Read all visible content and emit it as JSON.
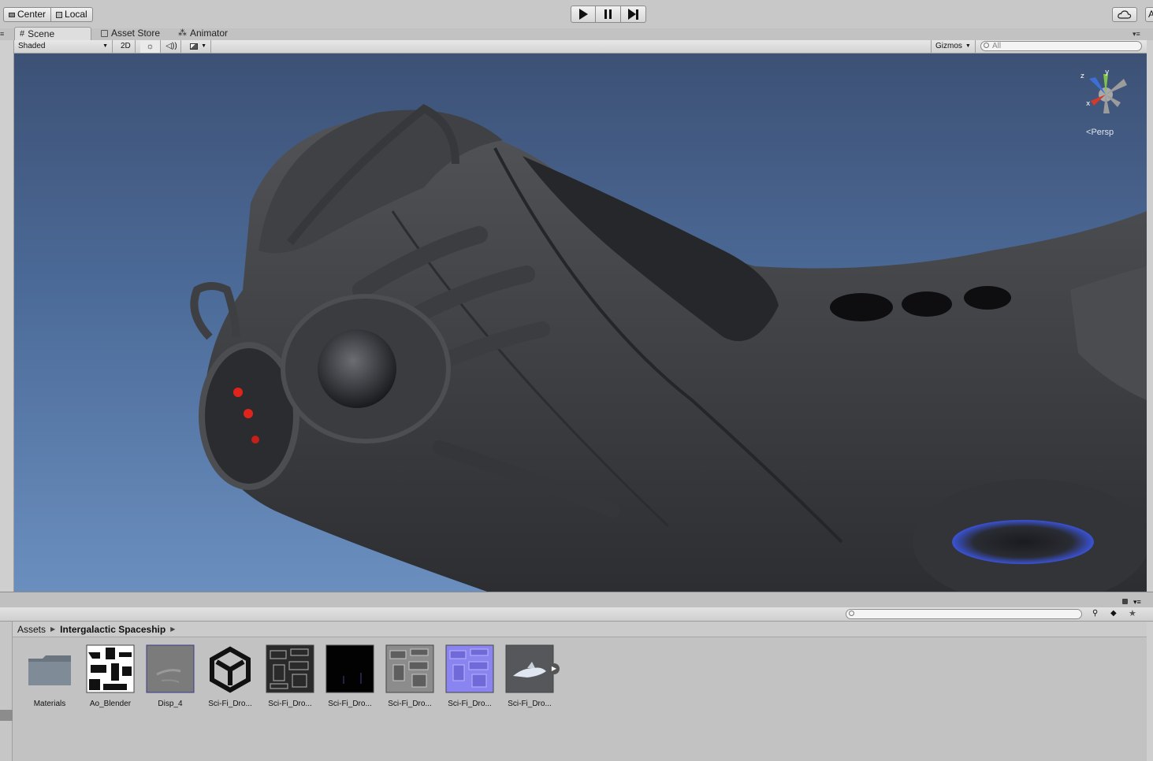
{
  "toolbar": {
    "center_label": "Center",
    "local_label": "Local",
    "cloud_icon": "cloud-icon",
    "account_initial": "A"
  },
  "tabs": [
    {
      "label": "Scene",
      "icon": "grid-icon",
      "active": true
    },
    {
      "label": "Asset Store",
      "icon": "store-icon",
      "active": false
    },
    {
      "label": "Animator",
      "icon": "animator-icon",
      "active": false
    }
  ],
  "scene_toolbar": {
    "shading_mode": "Shaded",
    "mode_2d": "2D",
    "gizmos_label": "Gizmos",
    "search_placeholder": "All"
  },
  "gizmo": {
    "axis_z": "z",
    "axis_y": "y",
    "axis_x": "x",
    "projection_label": "Persp",
    "colors": {
      "x": "#d23b2a",
      "y": "#7fc34a",
      "z": "#3d6fd4"
    }
  },
  "project": {
    "breadcrumb_root": "Assets",
    "breadcrumb_folder": "Intergalactic Spaceship",
    "search_placeholder": "",
    "assets": [
      {
        "label": "Materials",
        "kind": "folder"
      },
      {
        "label": "Ao_Blender",
        "kind": "texture-bw"
      },
      {
        "label": "Disp_4",
        "kind": "texture-gray"
      },
      {
        "label": "Sci-Fi_Dro...",
        "kind": "unity-logo"
      },
      {
        "label": "Sci-Fi_Dro...",
        "kind": "texture-dark"
      },
      {
        "label": "Sci-Fi_Dro...",
        "kind": "texture-black"
      },
      {
        "label": "Sci-Fi_Dro...",
        "kind": "texture-gray2"
      },
      {
        "label": "Sci-Fi_Dro...",
        "kind": "texture-normal"
      },
      {
        "label": "Sci-Fi_Dro...",
        "kind": "model"
      }
    ]
  }
}
